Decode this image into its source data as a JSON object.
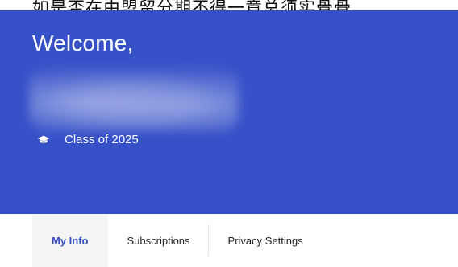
{
  "page": {
    "top_text": "如是否在由盟留分期不得一意总须实骨骨",
    "banner": {
      "welcome": "Welcome,",
      "class_icon": "graduation-cap-icon",
      "class_label": "Class of 2025"
    },
    "tabs": [
      {
        "label": "My Info",
        "active": true
      },
      {
        "label": "Subscriptions",
        "active": false
      },
      {
        "label": "Privacy Settings",
        "active": false
      }
    ],
    "colors": {
      "banner": "#3651c8",
      "active_tab_text": "#3651c8",
      "active_tab_bg": "#f5f5f5"
    }
  }
}
